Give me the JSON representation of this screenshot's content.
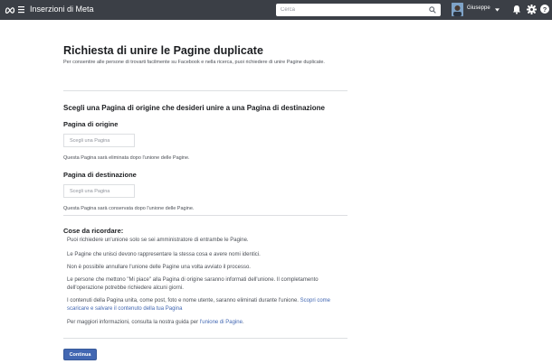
{
  "topbar": {
    "app_title": "Inserzioni di Meta",
    "search_placeholder": "Cerca",
    "user_name": "Giuseppe"
  },
  "page": {
    "title": "Richiesta di unire le Pagine duplicate",
    "description": "Per consentire alle persone di trovarti facilmente su Facebook e nella ricerca, puoi richiedere di unire Pagine duplicate.",
    "section_title": "Scegli una Pagina di origine che desideri unire a una Pagina di destinazione",
    "source": {
      "label": "Pagina di origine",
      "placeholder": "Scegli una Pagina",
      "help": "Questa Pagina sarà eliminata dopo l'unione delle Pagine."
    },
    "destination": {
      "label": "Pagina di destinazione",
      "placeholder": "Scegli una Pagina",
      "help": "Questa Pagina sarà conservata dopo l'unione delle Pagine."
    },
    "remember": {
      "title": "Cose da ricordare:",
      "note1": "Puoi richiedere un'unione solo se sei amministratore di entrambe le Pagine.",
      "note2": "Le Pagine che unisci devono rappresentare la stessa cosa e avere nomi identici.",
      "note3": "Non è possibile annullare l'unione delle Pagine una volta avviato il processo.",
      "note4": "Le persone che mettono \"Mi piace\" alla Pagina di origine saranno informati dell'unione. Il completamento dell'operazione potrebbe richiedere alcuni giorni.",
      "note5_text": "I contenuti della Pagina unita, come post, foto e nome utente, saranno eliminati durante l'unione. ",
      "note5_link": "Scopri come scaricare e salvare il contenuto della tua Pagina",
      "note6_text": "Per maggiori informazioni, consulta la nostra guida per ",
      "note6_link": "l'unione di Pagine",
      "note6_end": "."
    },
    "continue_label": "Continua"
  },
  "colors": {
    "topbar": "#3b3f46",
    "primary": "#4267b2",
    "link": "#4267b2",
    "divider": "#dddfe2"
  },
  "icons": [
    "meta-logo-icon",
    "hamburger-menu-icon",
    "search-icon",
    "caret-down-icon",
    "bell-icon",
    "gear-icon",
    "help-icon"
  ]
}
